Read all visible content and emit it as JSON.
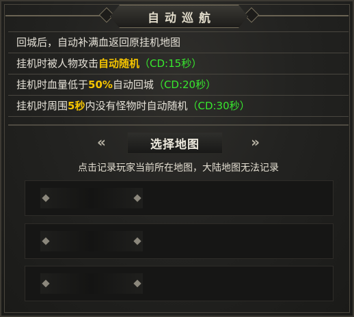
{
  "header": {
    "title": "自动巡航"
  },
  "rules": [
    {
      "parts": [
        {
          "text": "回城后，自动补满血返回原挂机地图",
          "style": "normal"
        }
      ]
    },
    {
      "parts": [
        {
          "text": "挂机时被人物攻击",
          "style": "normal"
        },
        {
          "text": "自动随机",
          "style": "yellow"
        },
        {
          "text": "（CD:15秒）",
          "style": "green"
        }
      ]
    },
    {
      "parts": [
        {
          "text": "挂机时血量低于",
          "style": "normal"
        },
        {
          "text": "50%",
          "style": "yellow"
        },
        {
          "text": "自动回城",
          "style": "normal"
        },
        {
          "text": "（CD:20秒）",
          "style": "green"
        }
      ]
    },
    {
      "parts": [
        {
          "text": "挂机时周围",
          "style": "normal"
        },
        {
          "text": "5秒",
          "style": "yellow"
        },
        {
          "text": "内没有怪物时自动随机",
          "style": "normal"
        },
        {
          "text": "（CD:30秒）",
          "style": "green"
        }
      ]
    }
  ],
  "select_map": {
    "label": "选择地图",
    "left_arrow": "«",
    "right_arrow": "»",
    "hint": "点击记录玩家当前所在地图，大陆地图无法记录"
  },
  "slots": [
    {
      "map": ""
    },
    {
      "map": ""
    },
    {
      "map": ""
    }
  ],
  "colors": {
    "yellow": "#f5c400",
    "green": "#38e82e",
    "text": "#e6e2d8"
  },
  "icons": [
    "double-chevron-left-icon",
    "double-chevron-right-icon",
    "diamond-icon"
  ]
}
